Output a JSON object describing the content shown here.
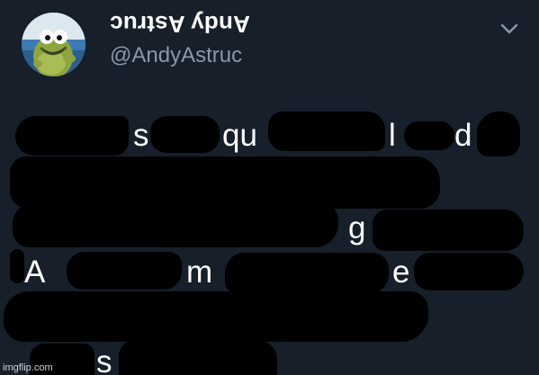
{
  "tweet": {
    "display_name": "Andy Astruc",
    "handle": "@AndyAstruc",
    "body_fragments": [
      "s",
      "qu",
      "l",
      "d",
      "g",
      "A",
      "m",
      "e",
      "s"
    ],
    "avatar_icon": "cartoon-fish-avatar",
    "menu_icon": "chevron-down-icon"
  },
  "watermark": {
    "text": "imgflip.com"
  },
  "colors": {
    "background": "#161f2a",
    "name_text": "#ffffff",
    "handle_text": "#8899a6",
    "body_text": "#ffffff",
    "redaction": "#000000"
  }
}
